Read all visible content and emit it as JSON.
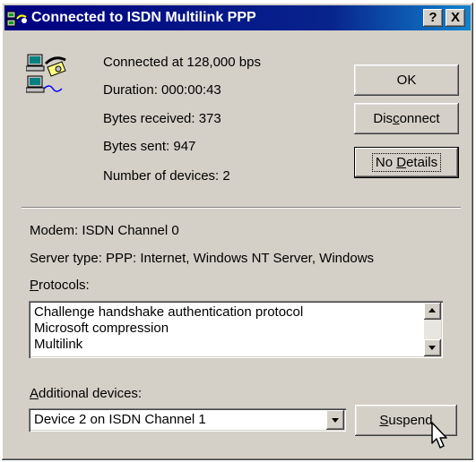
{
  "window": {
    "title": "Connected to ISDN Multilink PPP",
    "help_btn": "?",
    "close_btn": "X"
  },
  "status": {
    "connected": "Connected at 128,000 bps",
    "duration": "Duration:  000:00:43",
    "bytes_received": "Bytes received:  373",
    "bytes_sent": "Bytes sent:  947",
    "devices": "Number of devices:   2"
  },
  "buttons": {
    "ok": "OK",
    "disconnect_pre": "Dis",
    "disconnect_key": "c",
    "disconnect_post": "onnect",
    "details_pre": "No ",
    "details_key": "D",
    "details_post": "etails",
    "suspend_key": "S",
    "suspend_post": "uspend"
  },
  "details": {
    "modem": "Modem:  ISDN Channel 0",
    "server_type": "Server type:   PPP: Internet, Windows NT Server, Windows",
    "protocols_key": "P",
    "protocols_post": "rotocols:",
    "protocols": [
      "Challenge handshake authentication protocol",
      "Microsoft compression",
      "Multilink"
    ],
    "additional_key": "A",
    "additional_post": "dditional devices:",
    "selected_device": "Device 2 on ISDN Channel 1"
  },
  "icons": {
    "app": "dialup-network-icon",
    "connection": "connected-computers-phone-icon",
    "cursor": "mouse-pointer-icon"
  },
  "colors": {
    "face": "#d4d0c8",
    "titlebar": "#000080"
  }
}
